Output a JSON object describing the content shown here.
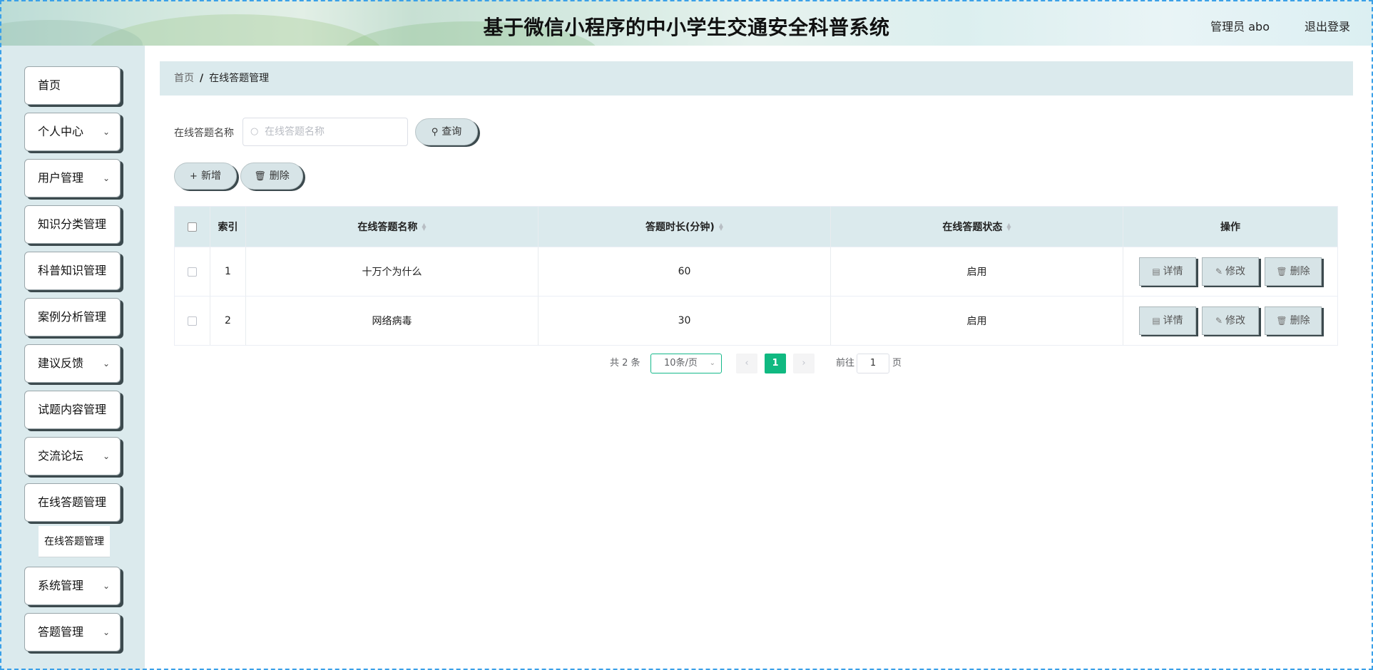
{
  "header": {
    "title": "基于微信小程序的中小学生交通安全科普系统",
    "user": "管理员 abo",
    "logout": "退出登录"
  },
  "sidebar": {
    "items": [
      {
        "label": "首页",
        "has_chevron": false
      },
      {
        "label": "个人中心",
        "has_chevron": true
      },
      {
        "label": "用户管理",
        "has_chevron": true
      },
      {
        "label": "知识分类管理",
        "has_chevron": true
      },
      {
        "label": "科普知识管理",
        "has_chevron": true
      },
      {
        "label": "案例分析管理",
        "has_chevron": true
      },
      {
        "label": "建议反馈",
        "has_chevron": true
      },
      {
        "label": "试题内容管理",
        "has_chevron": true
      },
      {
        "label": "交流论坛",
        "has_chevron": true
      },
      {
        "label": "在线答题管理",
        "has_chevron": true
      },
      {
        "label": "系统管理",
        "has_chevron": true
      },
      {
        "label": "答题管理",
        "has_chevron": true
      }
    ],
    "submenu": {
      "label": "在线答题管理"
    }
  },
  "breadcrumb": {
    "home": "首页",
    "separator": "/",
    "current": "在线答题管理"
  },
  "search": {
    "label": "在线答题名称",
    "placeholder": "在线答题名称",
    "button": "查询"
  },
  "actions": {
    "add": "新增",
    "delete": "删除"
  },
  "table": {
    "headers": {
      "index": "索引",
      "name": "在线答题名称",
      "duration": "答题时长(分钟)",
      "status": "在线答题状态",
      "operations": "操作"
    },
    "rows": [
      {
        "index": "1",
        "name": "十万个为什么",
        "duration": "60",
        "status": "启用"
      },
      {
        "index": "2",
        "name": "网络病毒",
        "duration": "30",
        "status": "启用"
      }
    ],
    "row_buttons": {
      "detail": "详情",
      "edit": "修改",
      "delete": "删除"
    }
  },
  "pagination": {
    "total": "共 2 条",
    "page_size": "10条/页",
    "current_page": "1",
    "goto_prefix": "前往",
    "goto_value": "1",
    "goto_suffix": "页"
  },
  "colors": {
    "accent": "#10b981",
    "panel": "#dbeaed"
  }
}
